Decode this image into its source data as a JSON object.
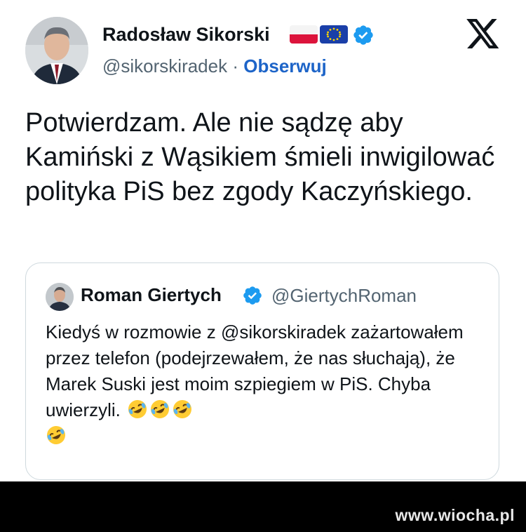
{
  "author": {
    "name": "Radosław Sikorski",
    "handle": "@sikorskiradek",
    "separator": "·",
    "follow_label": "Obserwuj",
    "flags": [
      "poland-flag-icon",
      "eu-flag-icon"
    ],
    "verified_icon": "verified-badge-icon"
  },
  "tweet": {
    "text": "Potwierdzam.  Ale nie sądzę aby Kamiński z Wąsikiem śmieli inwigilować polityka PiS bez zgody Kaczyńskiego."
  },
  "quoted_tweet": {
    "name": "Roman Giertych",
    "handle": "@GiertychRoman",
    "text": "Kiedyś w rozmowie z @sikorskiradek zażartowałem przez telefon (podejrzewałem, że nas słuchają), że Marek Suski jest moim szpiegiem w PiS. Chyba uwierzyli.",
    "emojis": [
      "rolling-on-floor-laughing-emoji",
      "rolling-on-floor-laughing-emoji",
      "rolling-on-floor-laughing-emoji",
      "rolling-on-floor-laughing-emoji"
    ]
  },
  "platform_icon": "x-logo-icon",
  "watermark": "www.wiocha.pl",
  "colors": {
    "text": "#0f1419",
    "secondary": "#536471",
    "follow": "#1d64c8",
    "verified": "#1d9bf0",
    "border": "#cfd9de"
  }
}
